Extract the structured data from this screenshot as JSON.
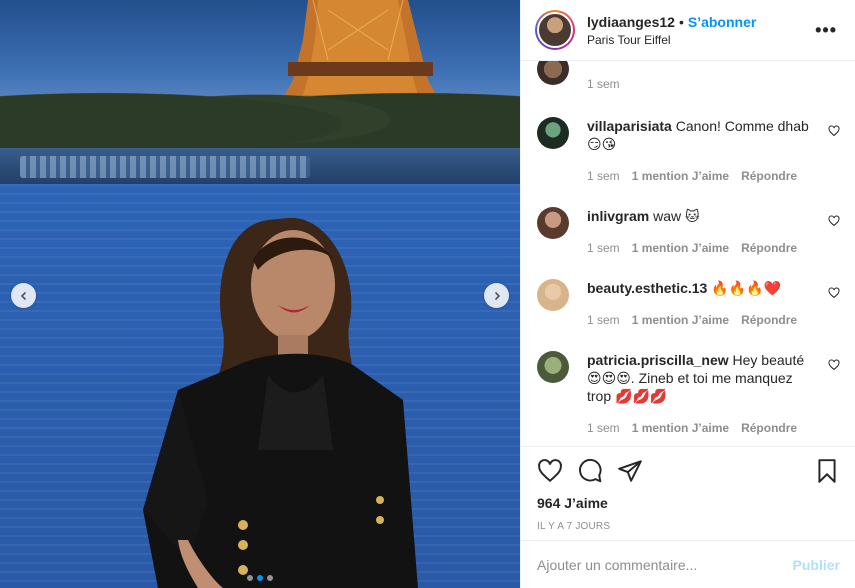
{
  "post": {
    "username": "lydiaanges12",
    "separator": "•",
    "follow_label": "S’abonner",
    "location": "Paris Tour Eiffel",
    "more_icon": "more-horizontal-icon"
  },
  "carousel": {
    "slide_count": 3,
    "active_index": 1
  },
  "comments": [
    {
      "username": "",
      "text": "",
      "time": "1 sem",
      "likes": "",
      "reply": ""
    },
    {
      "username": "villaparisiata",
      "text": "Canon! Comme dhab 😏😘",
      "time": "1 sem",
      "likes": "1 mention J’aime",
      "reply": "Répondre"
    },
    {
      "username": "inlivgram",
      "text": "waw 🐱",
      "time": "1 sem",
      "likes": "1 mention J’aime",
      "reply": "Répondre"
    },
    {
      "username": "beauty.esthetic.13",
      "text": "🔥🔥🔥❤️",
      "time": "1 sem",
      "likes": "1 mention J’aime",
      "reply": "Répondre"
    },
    {
      "username": "patricia.priscilla_new",
      "text": "Hey beauté 😍😍😍. Zineb et toi me manquez trop 💋💋💋",
      "time": "1 sem",
      "likes": "1 mention J’aime",
      "reply": "Répondre"
    }
  ],
  "actions": {
    "likes_count": "964 J’aime",
    "timestamp": "IL Y A 7 JOURS"
  },
  "composer": {
    "placeholder": "Ajouter un commentaire...",
    "publish_label": "Publier"
  },
  "colors": {
    "accent": "#0095f6",
    "publish_disabled": "#b2dffc",
    "meta_grey": "#8e8e8e"
  }
}
